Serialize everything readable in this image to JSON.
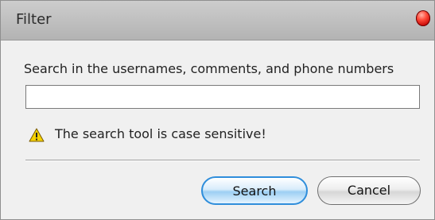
{
  "window": {
    "title": "Filter"
  },
  "filter": {
    "instructions": "Search in the usernames, comments, and phone numbers",
    "search_value": "",
    "search_placeholder": ""
  },
  "warning": {
    "text": "The search tool is case sensitive!",
    "icon": "warning-triangle-icon"
  },
  "buttons": {
    "search_label": "Search",
    "cancel_label": "Cancel"
  },
  "colors": {
    "primary_button_border": "#2f8edb",
    "close_button": "#d60000",
    "warning_yellow": "#f5d200"
  }
}
